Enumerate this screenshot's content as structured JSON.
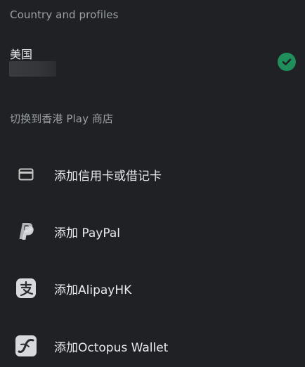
{
  "sections": {
    "country_header": "Country and profiles",
    "switch_header": "切换到香港 Play 商店"
  },
  "country": {
    "name": "美国",
    "selected": true
  },
  "payment_options": [
    {
      "label": "添加信用卡或借记卡",
      "icon": "credit-card-icon"
    },
    {
      "label": "添加 PayPal",
      "icon": "paypal-icon"
    },
    {
      "label": "添加AlipayHK",
      "icon": "alipayhk-icon"
    },
    {
      "label": "添加Octopus Wallet",
      "icon": "octopus-wallet-icon"
    }
  ],
  "colors": {
    "background": "#202124",
    "text_primary": "#e8eaed",
    "text_secondary": "#9aa0a6",
    "check_green": "#1e8e5a"
  }
}
